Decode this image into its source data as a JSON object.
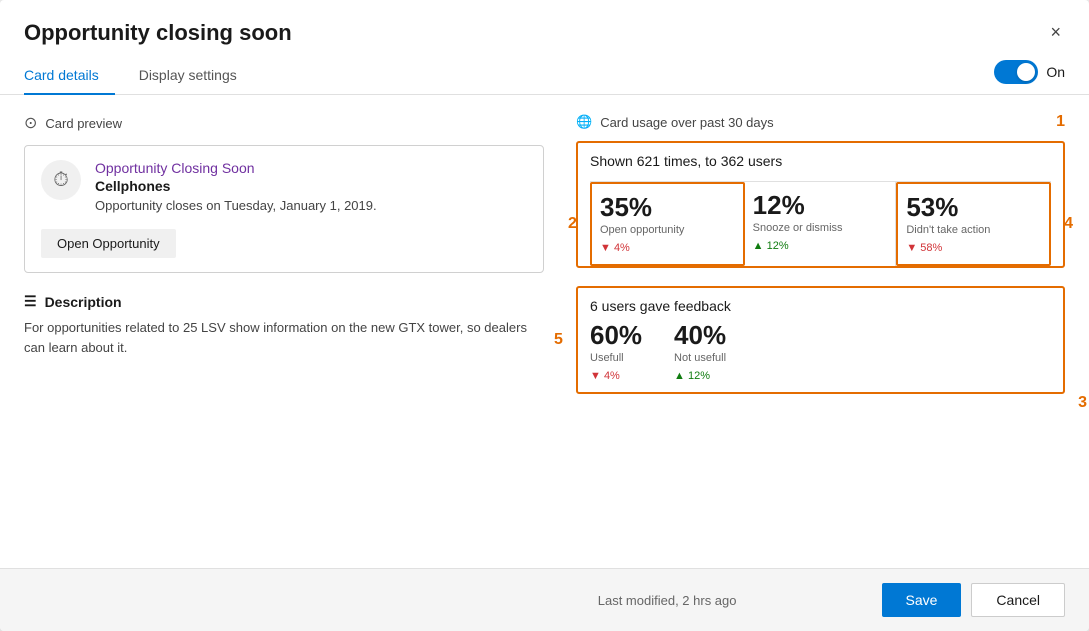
{
  "modal": {
    "title": "Opportunity closing soon",
    "close_btn": "×"
  },
  "tabs": {
    "items": [
      {
        "label": "Card details",
        "active": true
      },
      {
        "label": "Display settings",
        "active": false
      }
    ],
    "toggle_label": "On",
    "toggle_on": true
  },
  "card_preview": {
    "section_label": "Card preview",
    "opportunity_title": "Opportunity Closing Soon",
    "entity": "Cellphones",
    "description": "Opportunity closes on Tuesday, January 1, 2019.",
    "action_button": "Open Opportunity"
  },
  "description_section": {
    "label": "Description",
    "text": "For opportunities related to 25 LSV show information on the new GTX tower, so dealers can learn about it."
  },
  "usage": {
    "section_label": "Card usage over past 30 days",
    "annotation_1": "1",
    "shown_text": "Shown 621 times, to 362 users",
    "stats": [
      {
        "pct": "35%",
        "sublabel": "Open opportunity",
        "delta": "▼ 4%",
        "delta_type": "down"
      },
      {
        "pct": "12%",
        "sublabel": "Snooze or dismiss",
        "delta": "▲ 12%",
        "delta_type": "up"
      },
      {
        "pct": "53%",
        "sublabel": "Didn't take action",
        "delta": "▼ 58%",
        "delta_type": "down"
      }
    ],
    "annotation_2": "2",
    "annotation_3": "3",
    "annotation_4": "4",
    "feedback": {
      "title": "6 users gave feedback",
      "stats": [
        {
          "pct": "60%",
          "sublabel": "Usefull",
          "delta": "▼ 4%",
          "delta_type": "down"
        },
        {
          "pct": "40%",
          "sublabel": "Not usefull",
          "delta": "▲ 12%",
          "delta_type": "up"
        }
      ],
      "annotation_5": "5"
    }
  },
  "footer": {
    "modified": "Last modified, 2 hrs ago",
    "save_label": "Save",
    "cancel_label": "Cancel"
  }
}
